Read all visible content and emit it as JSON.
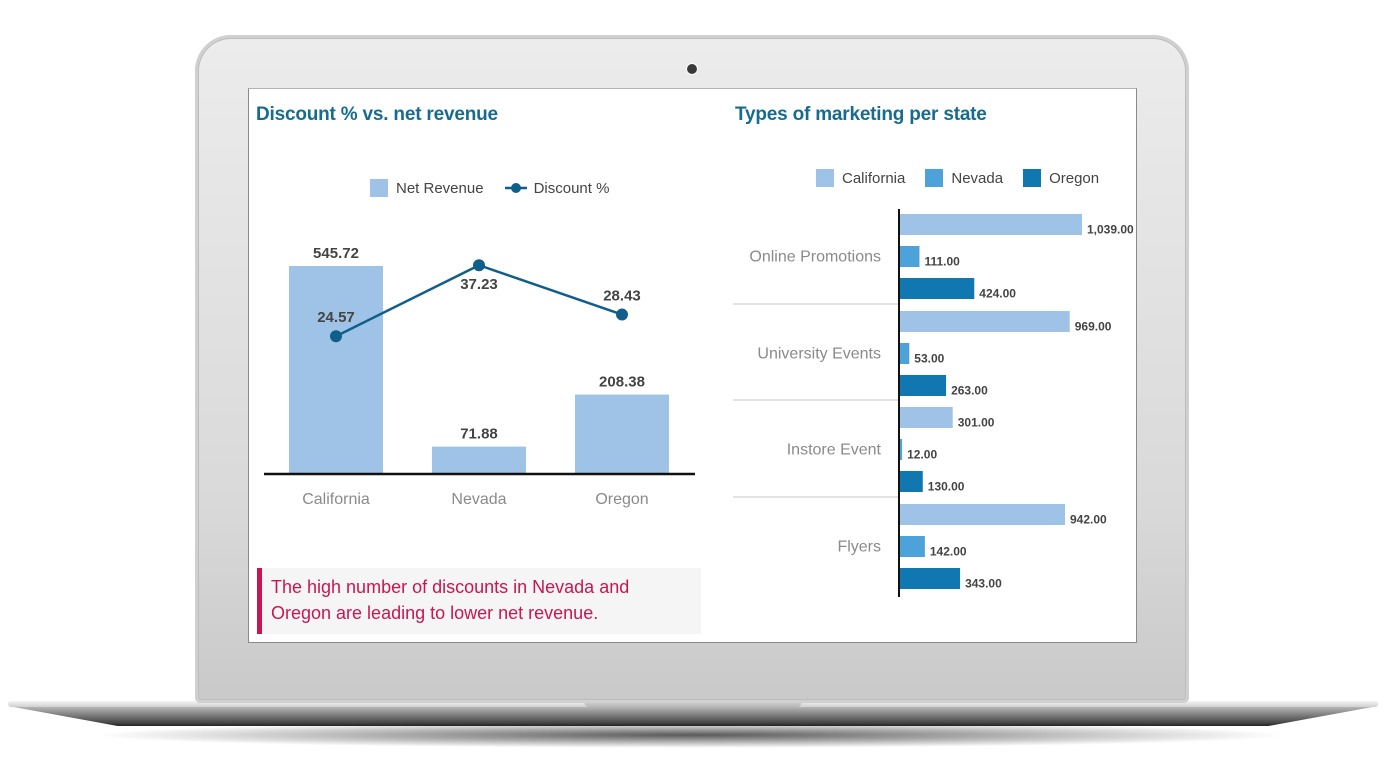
{
  "device": "laptop-mockup",
  "colors": {
    "title": "#176c8e",
    "net_revenue": "#9fc3e6",
    "discount_line": "#0f5f8a",
    "california": "#9fc3e6",
    "nevada": "#4da3d9",
    "oregon": "#1077b0",
    "insight": "#c8174f"
  },
  "left_panel": {
    "title": "Discount % vs. net revenue",
    "legend": [
      {
        "label": "Net Revenue",
        "icon": "square-swatch"
      },
      {
        "label": "Discount %",
        "icon": "line-marker"
      }
    ],
    "insight_text": "The high number of discounts in Nevada and Oregon are leading to lower net revenue."
  },
  "right_panel": {
    "title": "Types of marketing per state",
    "legend": [
      {
        "label": "California"
      },
      {
        "label": "Nevada"
      },
      {
        "label": "Oregon"
      }
    ]
  },
  "chart_data": [
    {
      "type": "bar",
      "title": "Discount % vs. net revenue",
      "categories": [
        "California",
        "Nevada",
        "Oregon"
      ],
      "series": [
        {
          "name": "Net Revenue",
          "kind": "bar",
          "values": [
            545.72,
            71.88,
            208.38
          ],
          "labels": [
            "545.72",
            "71.88",
            "208.38"
          ]
        },
        {
          "name": "Discount %",
          "kind": "line",
          "values": [
            24.57,
            37.23,
            28.43
          ],
          "labels": [
            "24.57",
            "37.23",
            "28.43"
          ]
        }
      ],
      "xlabel": "",
      "ylabel": "",
      "grid": false,
      "legend": "top-center"
    },
    {
      "type": "bar",
      "orientation": "horizontal",
      "title": "Types of marketing per state",
      "categories": [
        "Online Promotions",
        "University Events",
        "Instore Event",
        "Flyers"
      ],
      "series": [
        {
          "name": "California",
          "values": [
            1039,
            969,
            301,
            942
          ],
          "labels": [
            "1,039.00",
            "969.00",
            "301.00",
            "942.00"
          ]
        },
        {
          "name": "Nevada",
          "values": [
            111,
            53,
            12,
            142
          ],
          "labels": [
            "111.00",
            "53.00",
            "12.00",
            "142.00"
          ]
        },
        {
          "name": "Oregon",
          "values": [
            424,
            263,
            130,
            343
          ],
          "labels": [
            "424.00",
            "263.00",
            "130.00",
            "343.00"
          ]
        }
      ],
      "xlabel": "",
      "ylabel": "",
      "grid": false,
      "legend": "top-center"
    }
  ]
}
